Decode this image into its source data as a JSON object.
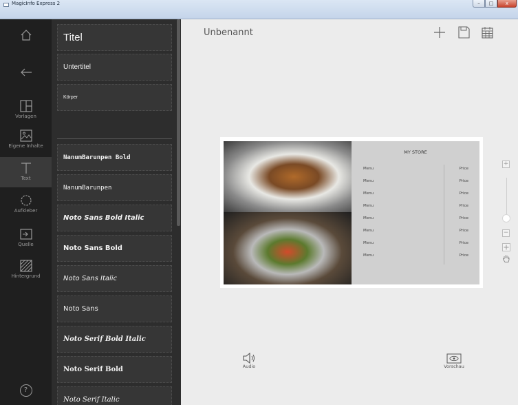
{
  "window": {
    "title": "MagicInfo Express 2",
    "min": "–",
    "max": "□",
    "close": "x"
  },
  "rail": {
    "home": "",
    "back": "",
    "items": [
      {
        "label": "Vorlagen",
        "icon": "layout-icon"
      },
      {
        "label": "Eigene Inhalte",
        "icon": "image-icon"
      },
      {
        "label": "Text",
        "icon": "text-icon",
        "active": true
      },
      {
        "label": "Aufkleber",
        "icon": "sticker-icon"
      },
      {
        "label": "Quelle",
        "icon": "source-icon"
      },
      {
        "label": "Hintergrund",
        "icon": "background-icon"
      }
    ],
    "help": "?"
  },
  "panel": {
    "title": "Titel",
    "subtitle": "Untertitel",
    "body": "Körper",
    "fonts": [
      "NanumBarunpen Bold",
      "NanumBarunpen",
      "Noto Sans Bold Italic",
      "Noto Sans Bold",
      "Noto Sans Italic",
      "Noto Sans",
      "Noto Serif Bold Italic",
      "Noto Serif Bold",
      "Noto Serif Italic"
    ]
  },
  "main": {
    "doc_title": "Unbenannt",
    "audio_label": "Audio",
    "preview_label": "Vorschau"
  },
  "menuboard": {
    "store": "MY STORE",
    "rows": [
      {
        "item": "Menu",
        "price": "Price"
      },
      {
        "item": "Menu",
        "price": "Price"
      },
      {
        "item": "Menu",
        "price": "Price"
      },
      {
        "item": "Menu",
        "price": "Price"
      },
      {
        "item": "Menu",
        "price": "Price"
      },
      {
        "item": "Menu",
        "price": "Price"
      },
      {
        "item": "Menu",
        "price": "Price"
      },
      {
        "item": "Menu",
        "price": "Price"
      }
    ]
  },
  "zoom": {
    "plus": "+",
    "minus": "−",
    "level": 0.5
  }
}
